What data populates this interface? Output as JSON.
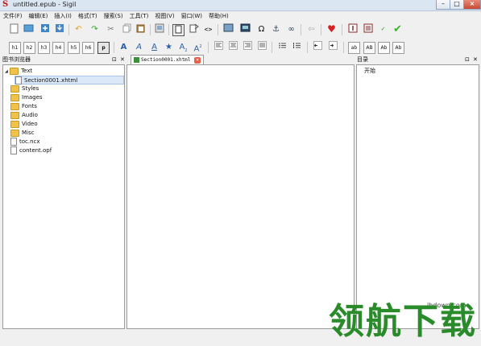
{
  "window": {
    "title": "untitled.epub - Sigil",
    "app_icon": "S"
  },
  "menubar": [
    "文件(F)",
    "编辑(E)",
    "插入(I)",
    "格式(T)",
    "搜索(S)",
    "工具(T)",
    "视图(V)",
    "窗口(W)",
    "帮助(H)"
  ],
  "heading_buttons": [
    "h1",
    "h2",
    "h3",
    "h4",
    "h5",
    "h6",
    "p"
  ],
  "case_buttons": [
    "ab",
    "AB",
    "Ab",
    "Ab"
  ],
  "book_browser": {
    "title": "图书浏览器",
    "tree": [
      {
        "label": "Text",
        "type": "folder",
        "expanded": true
      },
      {
        "label": "Section0001.xhtml",
        "type": "file",
        "selected": true
      },
      {
        "label": "Styles",
        "type": "folder"
      },
      {
        "label": "Images",
        "type": "folder"
      },
      {
        "label": "Fonts",
        "type": "folder"
      },
      {
        "label": "Audio",
        "type": "folder"
      },
      {
        "label": "Video",
        "type": "folder"
      },
      {
        "label": "Misc",
        "type": "folder"
      },
      {
        "label": "toc.ncx",
        "type": "file"
      },
      {
        "label": "content.opf",
        "type": "file"
      }
    ]
  },
  "editor": {
    "tab_label": "Section0001.xhtml"
  },
  "toc_panel": {
    "title": "目录",
    "entries": [
      "开始"
    ]
  },
  "watermark": {
    "text": "领航下载",
    "url": "lhdown.com"
  },
  "colors": {
    "titlebar": "#dbe6f3",
    "accent_green": "#2a8b2a"
  }
}
